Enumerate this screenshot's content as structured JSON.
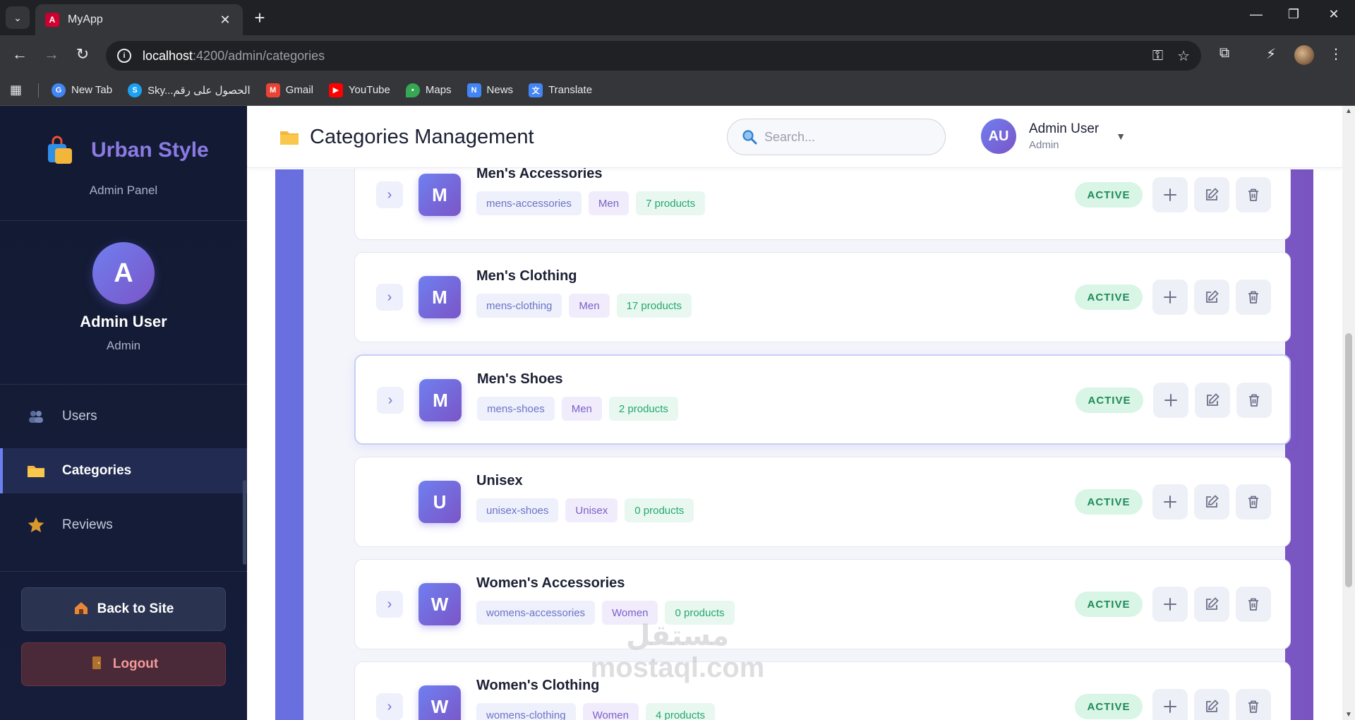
{
  "browser": {
    "tab_title": "MyApp",
    "url_host": "localhost",
    "url_path": ":4200/admin/categories",
    "bookmarks": [
      {
        "label": "New Tab",
        "icon": "google-icon",
        "color": "#4285f4"
      },
      {
        "label": "Sky...الحصول على رقم",
        "icon": "skype-icon",
        "color": "#1da1f2"
      },
      {
        "label": "Gmail",
        "icon": "gmail-icon",
        "color": "#ea4335"
      },
      {
        "label": "YouTube",
        "icon": "youtube-icon",
        "color": "#ff0000"
      },
      {
        "label": "Maps",
        "icon": "maps-icon",
        "color": "#34a853"
      },
      {
        "label": "News",
        "icon": "news-icon",
        "color": "#4285f4"
      },
      {
        "label": "Translate",
        "icon": "translate-icon",
        "color": "#4285f4"
      }
    ]
  },
  "sidebar": {
    "brand_name": "Urban Style",
    "brand_sub": "Admin Panel",
    "profile": {
      "initial": "A",
      "name": "Admin User",
      "role": "Admin"
    },
    "menu": [
      {
        "label": "Users",
        "icon": "users-icon",
        "active": false
      },
      {
        "label": "Categories",
        "icon": "folder-icon",
        "active": true
      },
      {
        "label": "Reviews",
        "icon": "star-icon",
        "active": false
      }
    ],
    "back_label": "Back to Site",
    "logout_label": "Logout"
  },
  "header": {
    "title": "Categories Management",
    "search_placeholder": "Search...",
    "user": {
      "initials": "AU",
      "name": "Admin User",
      "role": "Admin"
    }
  },
  "categories": [
    {
      "initial": "M",
      "name": "Men's Accessories",
      "slug": "mens-accessories",
      "gender": "Men",
      "count": "7 products",
      "status": "ACTIVE",
      "expandable": true
    },
    {
      "initial": "M",
      "name": "Men's Clothing",
      "slug": "mens-clothing",
      "gender": "Men",
      "count": "17 products",
      "status": "ACTIVE",
      "expandable": true
    },
    {
      "initial": "M",
      "name": "Men's Shoes",
      "slug": "mens-shoes",
      "gender": "Men",
      "count": "2 products",
      "status": "ACTIVE",
      "expandable": true
    },
    {
      "initial": "U",
      "name": "Unisex",
      "slug": "unisex-shoes",
      "gender": "Unisex",
      "count": "0 products",
      "status": "ACTIVE",
      "expandable": false
    },
    {
      "initial": "W",
      "name": "Women's Accessories",
      "slug": "womens-accessories",
      "gender": "Women",
      "count": "0 products",
      "status": "ACTIVE",
      "expandable": true
    },
    {
      "initial": "W",
      "name": "Women's Clothing",
      "slug": "womens-clothing",
      "gender": "Women",
      "count": "4 products",
      "status": "ACTIVE",
      "expandable": true
    }
  ],
  "watermark": "مستقل mostaql.com",
  "colors": {
    "accent": "#6c7ff2",
    "active_status": "#1f8a58",
    "sidebar_bg": "#131a33"
  }
}
